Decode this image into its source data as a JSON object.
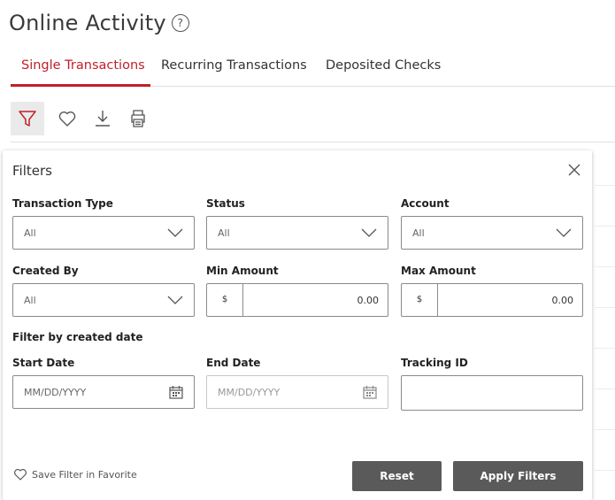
{
  "page": {
    "title": "Online Activity",
    "help_icon": "?"
  },
  "tabs": [
    {
      "label": "Single Transactions",
      "active": true
    },
    {
      "label": "Recurring Transactions",
      "active": false
    },
    {
      "label": "Deposited Checks",
      "active": false
    }
  ],
  "toolbar": {
    "icons": [
      "filter-icon",
      "heart-icon",
      "download-icon",
      "print-icon"
    ]
  },
  "filters": {
    "title": "Filters",
    "transaction_type": {
      "label": "Transaction Type",
      "value": "All"
    },
    "status": {
      "label": "Status",
      "value": "All"
    },
    "account": {
      "label": "Account",
      "value": "All"
    },
    "created_by": {
      "label": "Created By",
      "value": "All"
    },
    "min_amount": {
      "label": "Min Amount",
      "currency": "$",
      "value": "0.00"
    },
    "max_amount": {
      "label": "Max Amount",
      "currency": "$",
      "value": "0.00"
    },
    "created_date_heading": "Filter by created date",
    "start_date": {
      "label": "Start Date",
      "placeholder": "MM/DD/YYYY"
    },
    "end_date": {
      "label": "End Date",
      "placeholder": "MM/DD/YYYY"
    },
    "tracking_id": {
      "label": "Tracking ID",
      "value": ""
    },
    "save_favorite": "Save Filter in Favorite",
    "reset": "Reset",
    "apply": "Apply Filters"
  },
  "colors": {
    "accent": "#c0202a",
    "button": "#5a5a5a",
    "border": "#8a8a8a"
  }
}
